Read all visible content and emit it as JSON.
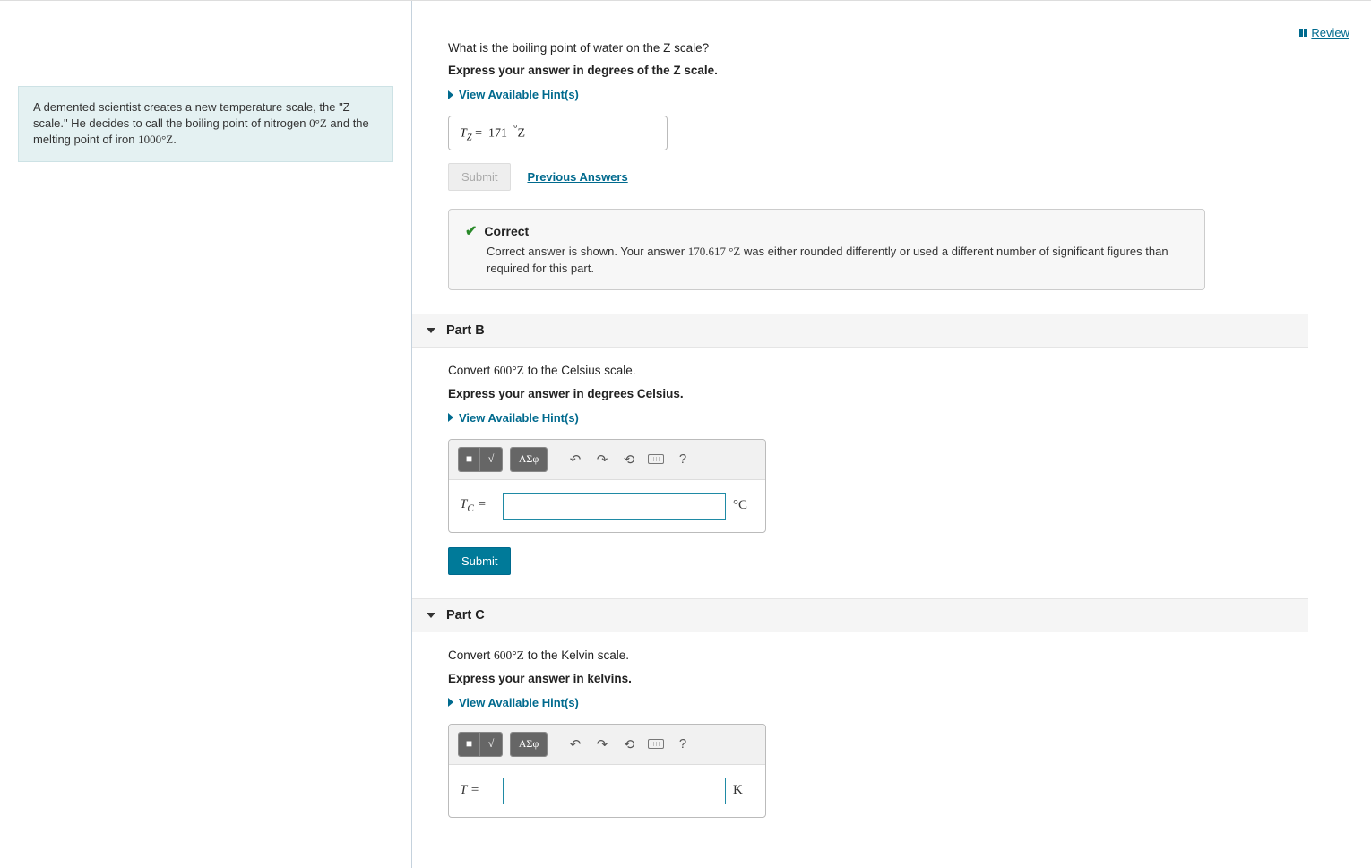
{
  "review": {
    "label": "Review"
  },
  "problem": {
    "text_prefix": "A demented scientist creates a new temperature scale, the \"Z scale.\" He decides to call the boiling point of nitrogen ",
    "nitrogen_point": "0°Z",
    "text_mid": " and the melting point of iron ",
    "iron_point": "1000°Z",
    "text_suffix": "."
  },
  "partA": {
    "prompt": "What is the boiling point of water on the Z scale?",
    "instruction": "Express your answer in degrees of the Z scale.",
    "hints_label": "View Available Hint(s)",
    "answer_lhs": "T",
    "answer_sub": "Z",
    "answer_eq": " = ",
    "answer_value": "171",
    "answer_unit_deg": "°",
    "answer_unit": "Z",
    "submit_label": "Submit",
    "prev_answers_label": "Previous Answers",
    "feedback_title": "Correct",
    "feedback_text_pre": "Correct answer is shown. Your answer ",
    "feedback_user_answer": "170.617 °Z",
    "feedback_text_post": " was either rounded differently or used a different number of significant figures than required for this part."
  },
  "partB": {
    "header": "Part B",
    "prompt_pre": "Convert ",
    "prompt_val": "600°Z",
    "prompt_post": " to the Celsius scale.",
    "instruction": "Express your answer in degrees Celsius.",
    "hints_label": "View Available Hint(s)",
    "lhs": "T",
    "lhs_sub": "C",
    "eq": " = ",
    "unit": "°C",
    "submit_label": "Submit"
  },
  "partC": {
    "header": "Part C",
    "prompt_pre": "Convert ",
    "prompt_val": "600°Z",
    "prompt_post": " to the Kelvin scale.",
    "instruction": "Express your answer in kelvins.",
    "hints_label": "View Available Hint(s)",
    "lhs": "T",
    "eq": " = ",
    "unit": "K"
  },
  "toolbar": {
    "btn1": "■",
    "btn2": "√",
    "btn3": "ΑΣφ"
  }
}
